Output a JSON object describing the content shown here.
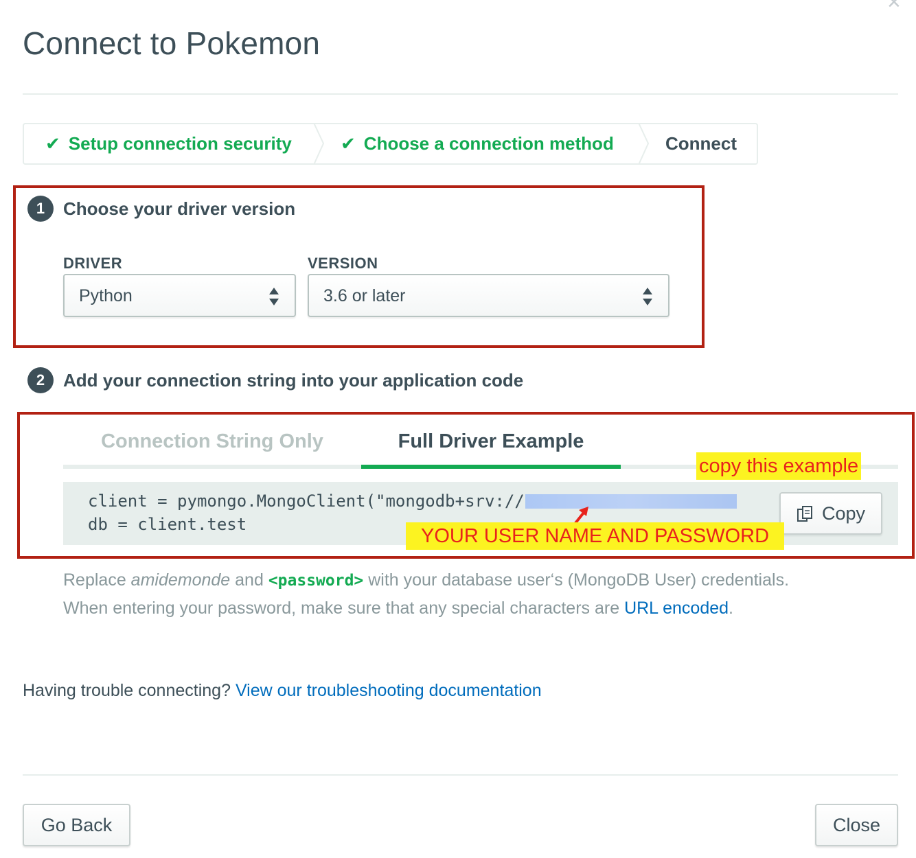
{
  "modal": {
    "title": "Connect to Pokemon",
    "close_icon": "close-icon"
  },
  "steps": {
    "items": [
      {
        "label": "Setup connection security",
        "status": "done",
        "icon": "check-icon"
      },
      {
        "label": "Choose a connection method",
        "status": "done",
        "icon": "check-icon"
      },
      {
        "label": "Connect",
        "status": "current"
      }
    ],
    "done_color": "#13aa52"
  },
  "section1": {
    "number": "1",
    "heading": "Choose your driver version",
    "driver_label": "DRIVER",
    "driver_value": "Python",
    "version_label": "VERSION",
    "version_value": "3.6 or later"
  },
  "section2": {
    "number": "2",
    "heading": "Add your connection string into your application code",
    "tabs": [
      {
        "label": "Connection String Only",
        "active": false
      },
      {
        "label": "Full Driver Example",
        "active": true
      }
    ],
    "code": {
      "line1": "client = pymongo.MongoClient(\"mongodb+srv://",
      "line2": "db = client.test"
    },
    "copy_label": "Copy",
    "copy_icon": "copy-icon"
  },
  "annotations": {
    "copy_note": "copy this example",
    "credentials_note": "YOUR USER NAME AND PASSWORD",
    "box_color": "#b22113",
    "note_bg": "#fcf321",
    "note_text_color": "#e8231c"
  },
  "help": {
    "line1_pre": "Replace ",
    "line1_user": "amidemonde",
    "line1_and": " and ",
    "line1_pw": "<password>",
    "line1_post": " with your database user‘s (MongoDB User) credentials.",
    "line2_pre": "When entering your password, make sure that any special characters are ",
    "line2_link": "URL encoded",
    "line2_post": "."
  },
  "trouble": {
    "text": "Having trouble connecting? ",
    "link": "View our troubleshooting documentation"
  },
  "footer": {
    "back_label": "Go Back",
    "close_label": "Close"
  }
}
